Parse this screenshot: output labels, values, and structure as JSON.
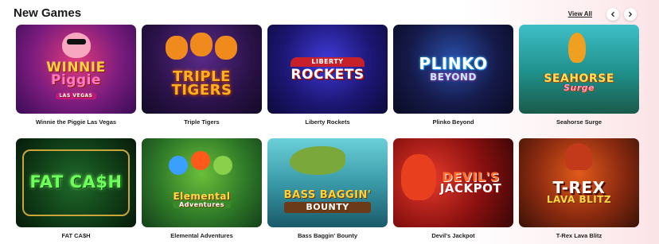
{
  "section": {
    "title": "New Games",
    "view_all": "View All"
  },
  "nav": {
    "prev_icon": "chevron-left-icon",
    "next_icon": "chevron-right-icon"
  },
  "games": [
    {
      "name": "Winnie the Piggie Las Vegas",
      "logo_line1": "WINNIE",
      "logo_line2": "Piggie",
      "logo_badge": "LAS VEGAS"
    },
    {
      "name": "Triple Tigers",
      "logo_line1": "TRIPLE",
      "logo_line2": "TIGERS"
    },
    {
      "name": "Liberty Rockets",
      "logo_line1": "LIBERTY",
      "logo_line2": "ROCKETS"
    },
    {
      "name": "Plinko Beyond",
      "logo_line1": "PLINKO",
      "logo_line2": "BEYOND"
    },
    {
      "name": "Seahorse Surge",
      "logo_line1": "SEAHORSE",
      "logo_line2": "Surge"
    },
    {
      "name": "FAT CA$H",
      "logo_line1": "FAT CA$H"
    },
    {
      "name": "Elemental Adventures",
      "logo_line1": "Elemental",
      "logo_line2": "Adventures"
    },
    {
      "name": "Bass Baggin' Bounty",
      "logo_line1": "BASS BAGGIN'",
      "logo_line2": "BOUNTY"
    },
    {
      "name": "Devil's Jackpot",
      "logo_line1": "DEVIL'S",
      "logo_line2": "JACKPOT"
    },
    {
      "name": "T-Rex Lava Blitz",
      "logo_line1": "T-REX",
      "logo_line2": "LAVA BLITZ"
    }
  ]
}
